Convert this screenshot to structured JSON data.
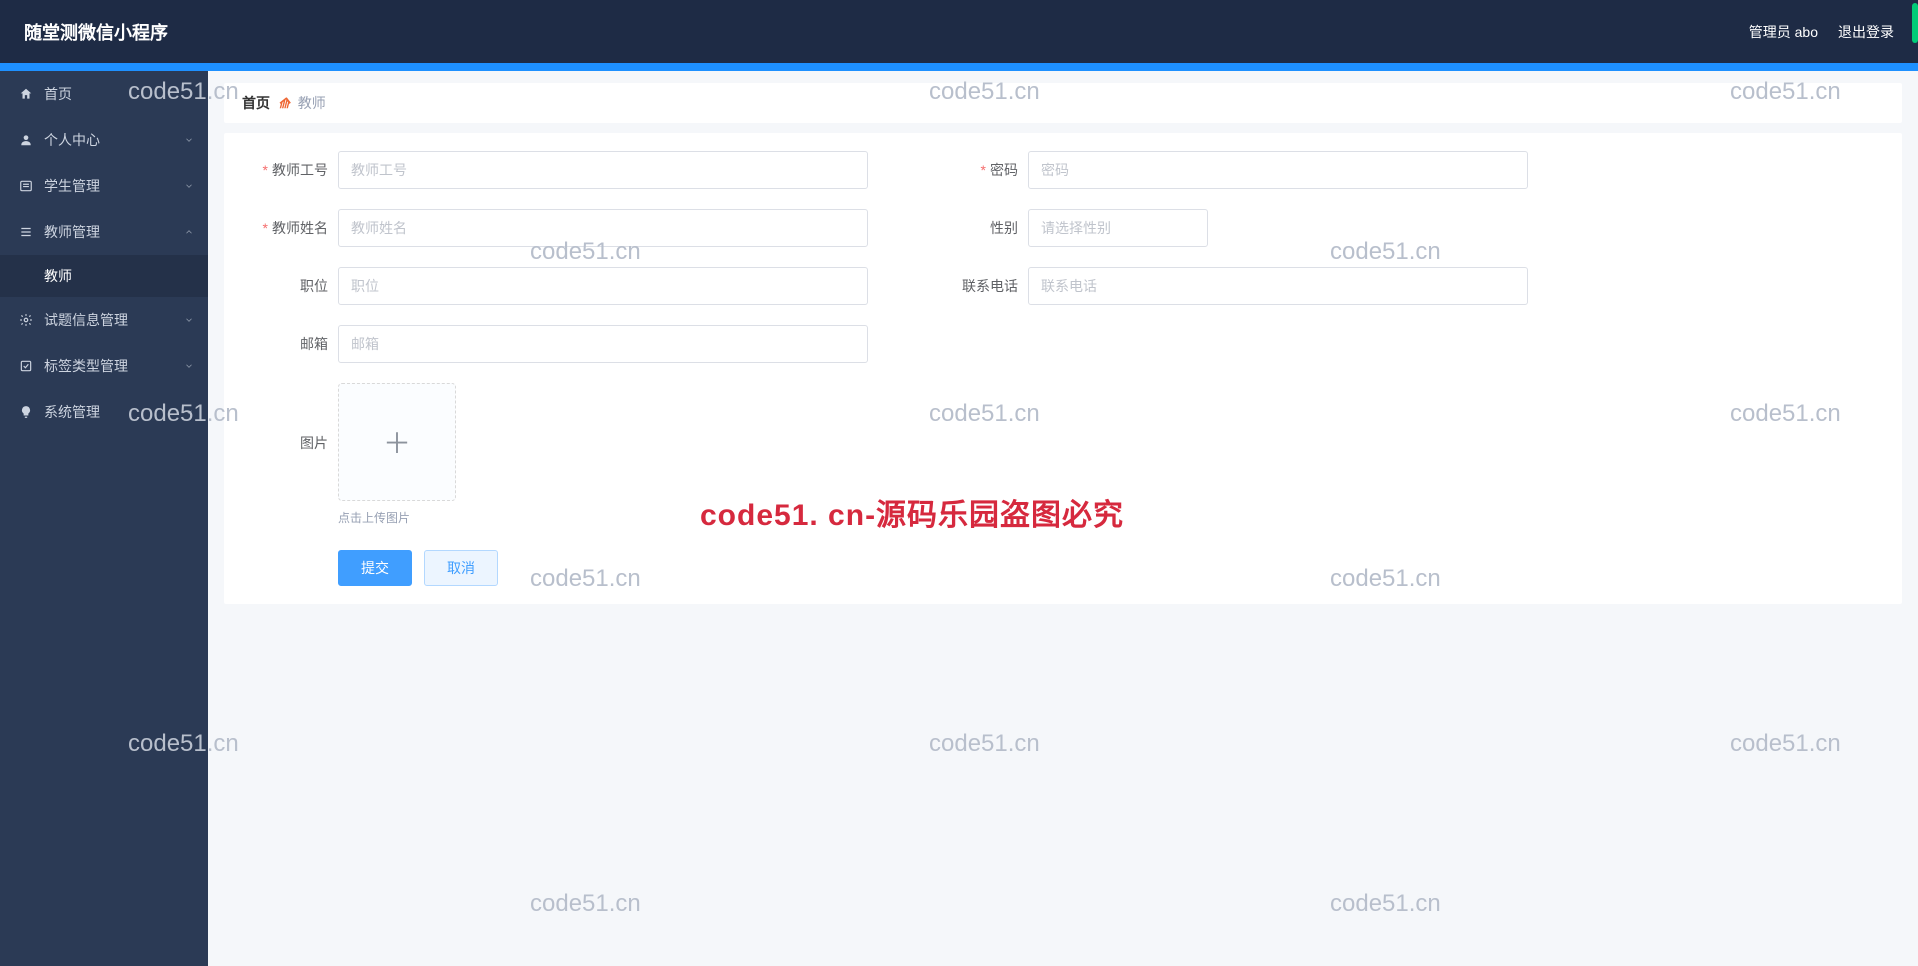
{
  "header": {
    "title": "随堂测微信小程序",
    "admin_label": "管理员 abo",
    "logout_label": "退出登录"
  },
  "sidebar": {
    "items": [
      {
        "label": "首页",
        "icon": "home-icon",
        "expandable": false
      },
      {
        "label": "个人中心",
        "icon": "user-icon",
        "expandable": true
      },
      {
        "label": "学生管理",
        "icon": "list-icon",
        "expandable": true
      },
      {
        "label": "教师管理",
        "icon": "menu-icon",
        "expandable": true,
        "expanded": true,
        "children": [
          {
            "label": "教师"
          }
        ]
      },
      {
        "label": "试题信息管理",
        "icon": "gear-icon",
        "expandable": true
      },
      {
        "label": "标签类型管理",
        "icon": "check-icon",
        "expandable": true
      },
      {
        "label": "系统管理",
        "icon": "bulb-icon",
        "expandable": true
      }
    ]
  },
  "breadcrumb": {
    "root": "首页",
    "current": "教师"
  },
  "form": {
    "teacher_id": {
      "label": "教师工号",
      "placeholder": "教师工号",
      "required": true
    },
    "password": {
      "label": "密码",
      "placeholder": "密码",
      "required": true
    },
    "name": {
      "label": "教师姓名",
      "placeholder": "教师姓名",
      "required": true
    },
    "gender": {
      "label": "性别",
      "placeholder": "请选择性别",
      "required": false
    },
    "position": {
      "label": "职位",
      "placeholder": "职位",
      "required": false
    },
    "phone": {
      "label": "联系电话",
      "placeholder": "联系电话",
      "required": false
    },
    "email": {
      "label": "邮箱",
      "placeholder": "邮箱",
      "required": false
    },
    "image": {
      "label": "图片",
      "tip": "点击上传图片"
    },
    "submit_label": "提交",
    "cancel_label": "取消"
  },
  "watermark": {
    "small": "code51.cn",
    "big": "code51. cn-源码乐园盗图必究"
  }
}
